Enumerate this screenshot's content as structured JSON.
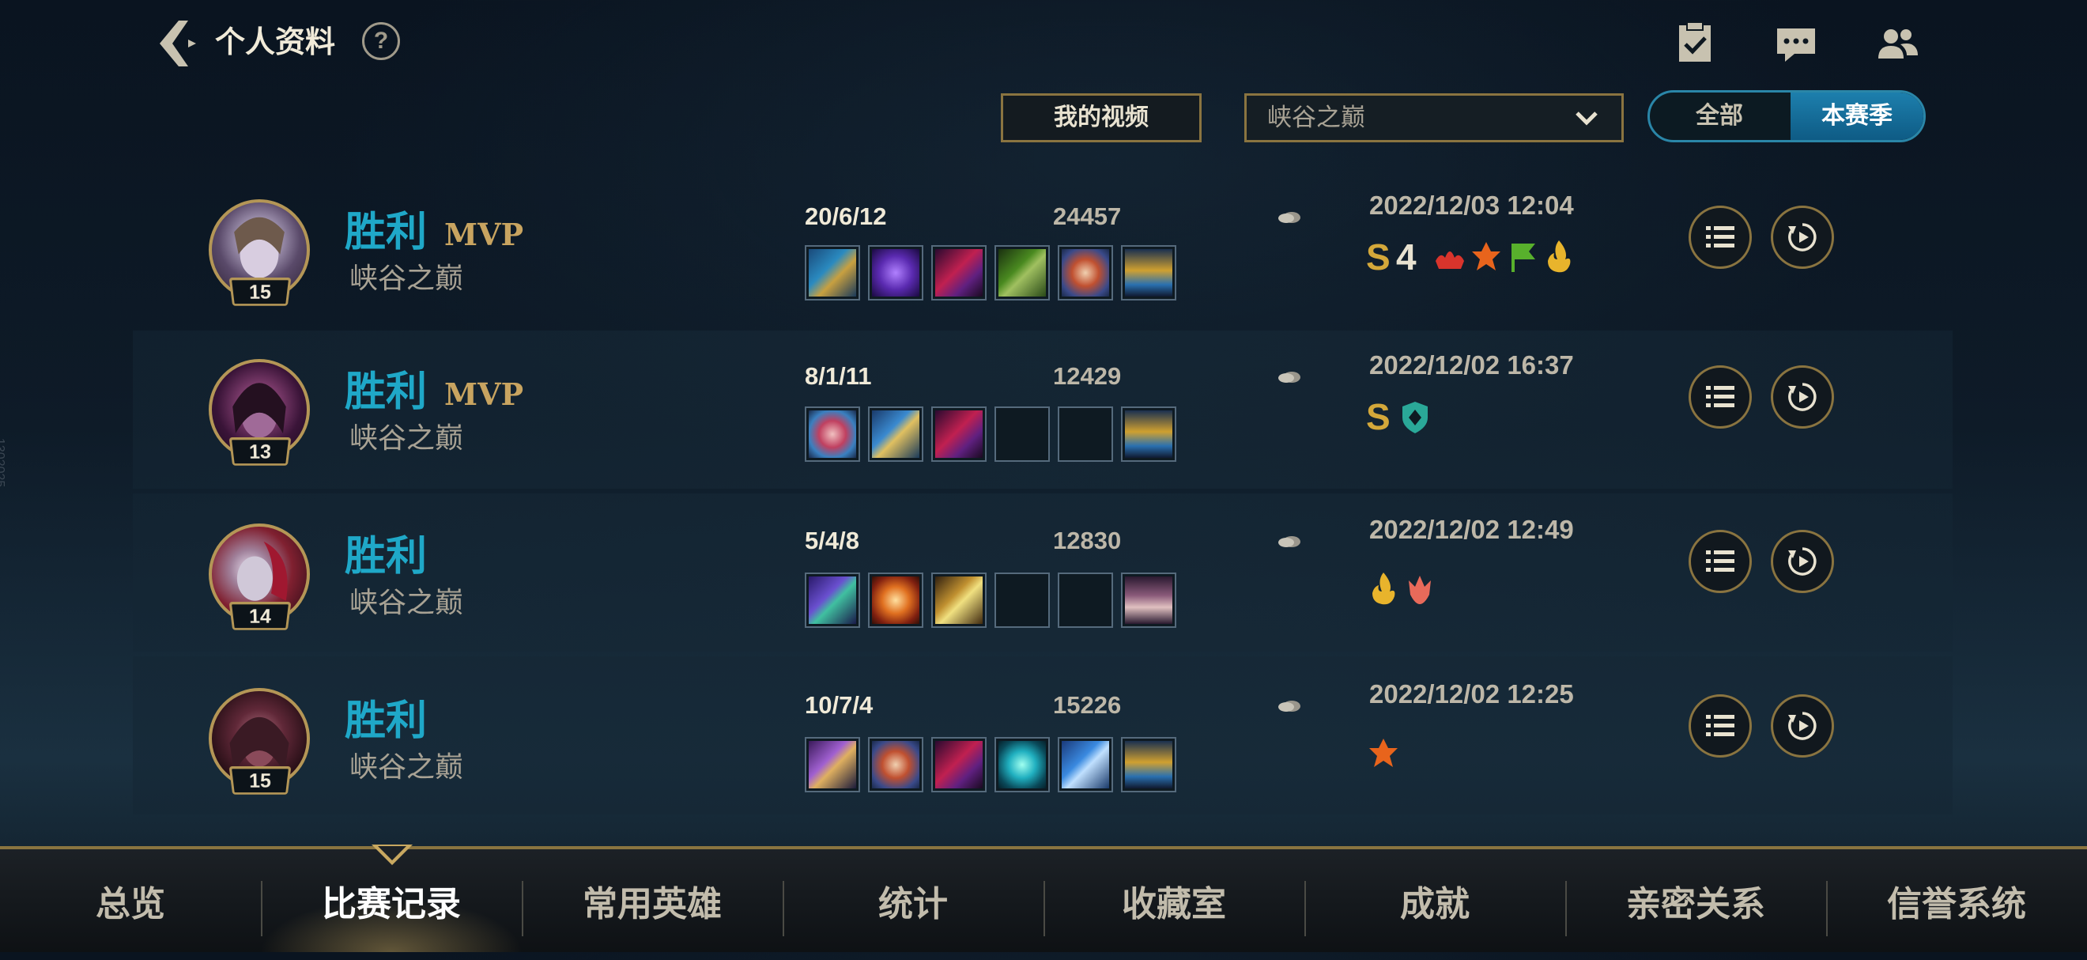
{
  "header": {
    "title": "个人资料",
    "help_label": "?",
    "icons": [
      "back-icon",
      "help-icon",
      "task-icon",
      "chat-icon",
      "friends-icon"
    ]
  },
  "filters": {
    "my_videos_label": "我的视频",
    "queue_selected": "峡谷之巅",
    "season_toggle": {
      "all_label": "全部",
      "season_label": "本赛季",
      "active": "本赛季"
    }
  },
  "matches": [
    {
      "result": "胜利",
      "mvp": "MVP",
      "queue": "峡谷之巅",
      "level": "15",
      "kda": "20/6/12",
      "gold": "24457",
      "datetime": "2022/12/03 12:04",
      "badge_rank": "S",
      "badge_streak": "4"
    },
    {
      "result": "胜利",
      "mvp": "MVP",
      "queue": "峡谷之巅",
      "level": "13",
      "kda": "8/1/11",
      "gold": "12429",
      "datetime": "2022/12/02 16:37",
      "badge_rank": "S"
    },
    {
      "result": "胜利",
      "queue": "峡谷之巅",
      "level": "14",
      "kda": "5/4/8",
      "gold": "12830",
      "datetime": "2022/12/02 12:49"
    },
    {
      "result": "胜利",
      "queue": "峡谷之巅",
      "level": "15",
      "kda": "10/7/4",
      "gold": "15226",
      "datetime": "2022/12/02 12:25"
    }
  ],
  "tabs": [
    {
      "label": "总览"
    },
    {
      "label": "比赛记录",
      "active": true
    },
    {
      "label": "常用英雄"
    },
    {
      "label": "统计"
    },
    {
      "label": "收藏室"
    },
    {
      "label": "成就"
    },
    {
      "label": "亲密关系"
    },
    {
      "label": "信誉系统"
    }
  ],
  "side_watermark": "1302025",
  "colors": {
    "accent_gold": "#b49656",
    "win_blue": "#1fa8c8",
    "toggle_blue": "#1d7fad"
  }
}
